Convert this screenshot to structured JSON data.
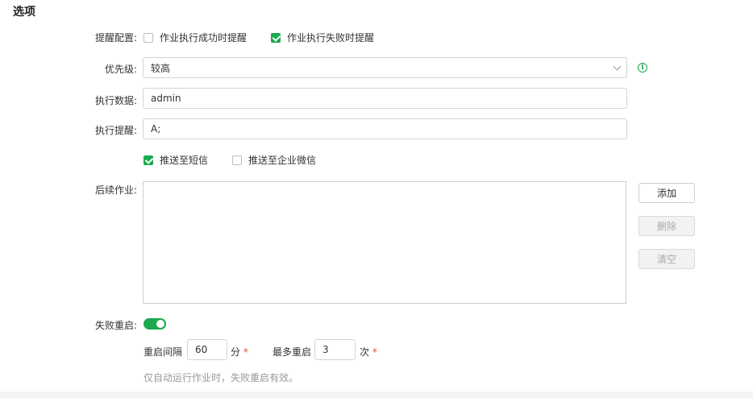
{
  "section": {
    "title": "选项"
  },
  "reminder": {
    "label": "提醒配置:",
    "options": [
      {
        "label": "作业执行成功时提醒",
        "checked": false
      },
      {
        "label": "作业执行失败时提醒",
        "checked": true
      }
    ]
  },
  "priority": {
    "label": "优先级:",
    "value": "较高",
    "info_icon": "info-circle-icon"
  },
  "exec_data": {
    "label": "执行数据:",
    "value": "admin"
  },
  "exec_reminder": {
    "label": "执行提醒:",
    "value": "A;"
  },
  "push": {
    "options": [
      {
        "label": "推送至短信",
        "checked": true
      },
      {
        "label": "推送至企业微信",
        "checked": false
      }
    ]
  },
  "follow_up": {
    "label": "后续作业:",
    "buttons": {
      "add": "添加",
      "delete": "删除",
      "clear": "清空"
    }
  },
  "failure_restart": {
    "label": "失败重启:",
    "enabled": true,
    "interval_label": "重启间隔",
    "interval_value": "60",
    "interval_unit": "分",
    "max_label": "最多重启",
    "max_value": "3",
    "max_unit": "次",
    "required_mark": "*",
    "hint": "仅自动运行作业时，失败重启有效。"
  },
  "colors": {
    "accent": "#1aa94b",
    "required": "#e64a3b"
  }
}
